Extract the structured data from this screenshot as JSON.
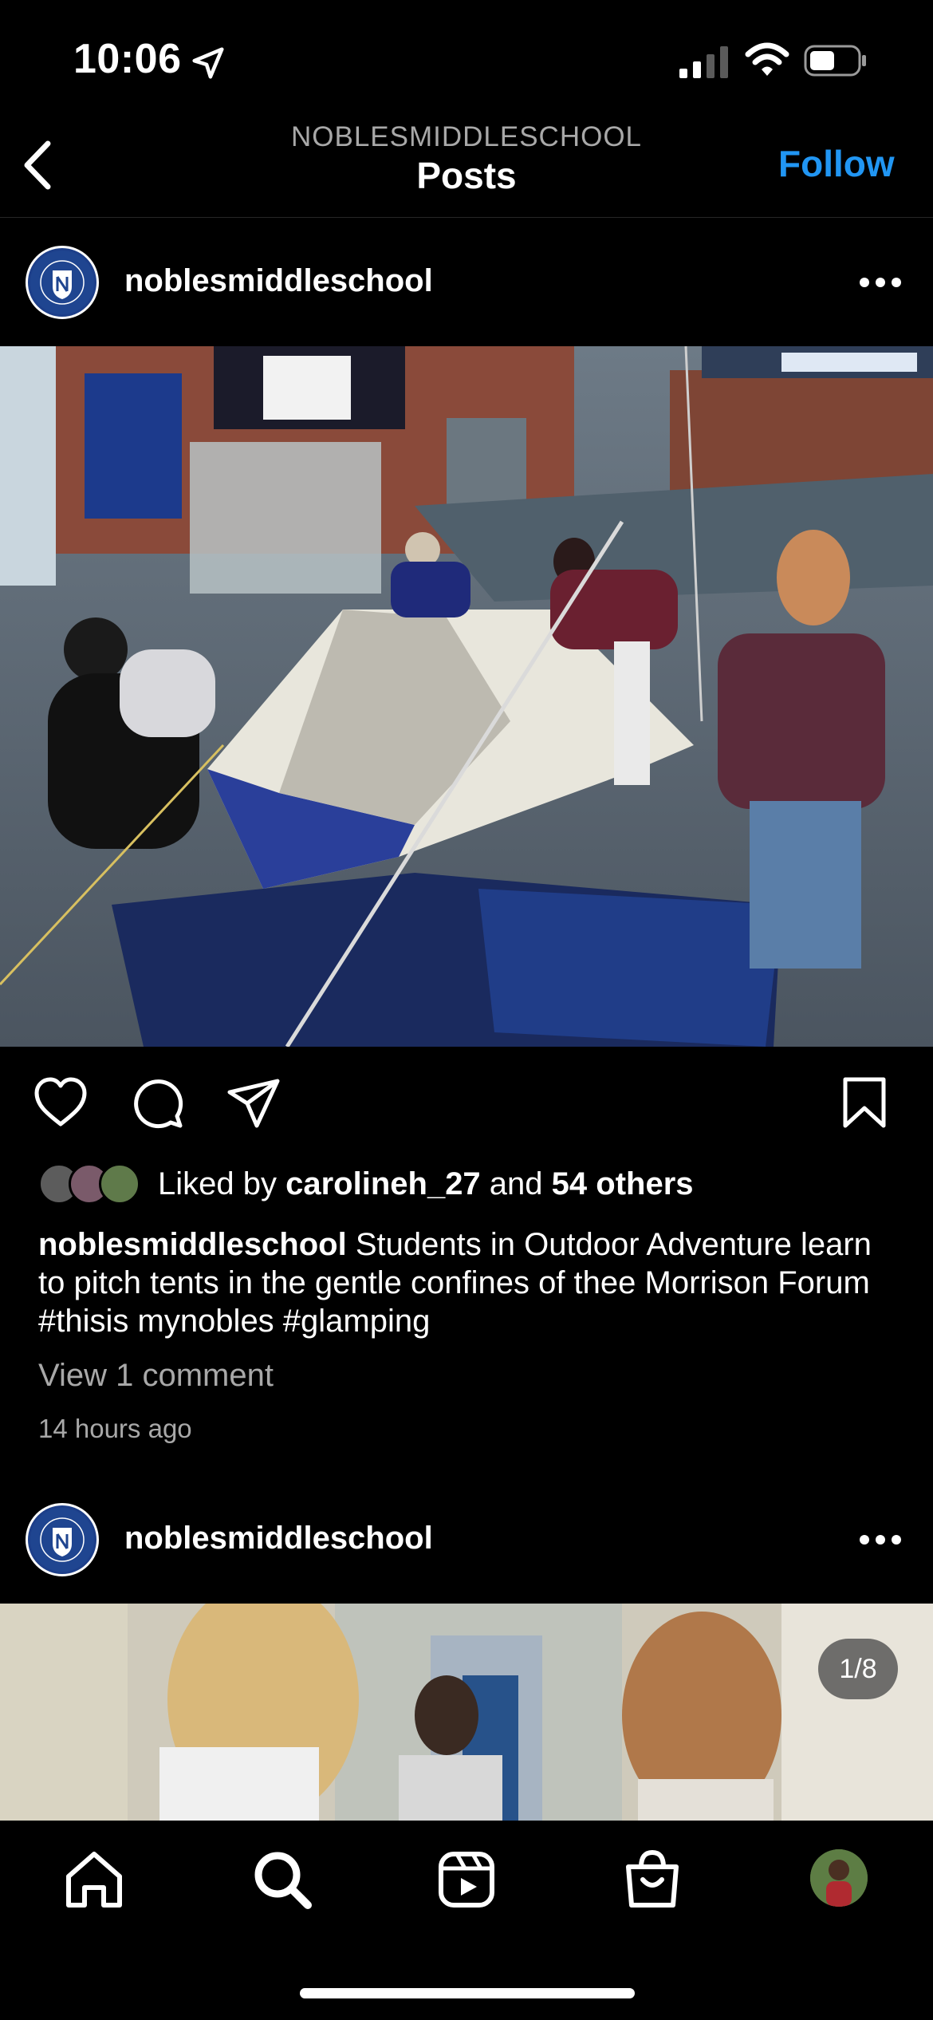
{
  "status_bar": {
    "time": "10:06"
  },
  "header": {
    "account": "NOBLESMIDDLESCHOOL",
    "title": "Posts",
    "follow_label": "Follow"
  },
  "post1": {
    "username": "noblesmiddleschool",
    "liked_by_prefix": "Liked by ",
    "liked_by_user": "carolineh_27",
    "liked_by_and": " and ",
    "liked_by_others": "54 others",
    "caption_user": "noblesmiddleschool",
    "caption_text": " Students in Outdoor Adventure learn to pitch tents in the gentle confines of thee Morrison Forum #thisis mynobles #glamping",
    "view_comments": "View 1 comment",
    "time_ago": "14 hours ago"
  },
  "post2": {
    "username": "noblesmiddleschool",
    "carousel_counter": "1/8"
  },
  "icons": {
    "status": [
      "location-arrow-icon",
      "signal-icon",
      "wifi-icon",
      "battery-icon"
    ],
    "header": [
      "back-chevron-icon"
    ],
    "post_actions": [
      "heart-icon",
      "comment-icon",
      "share-icon",
      "bookmark-icon"
    ],
    "tabs": [
      "home-icon",
      "search-icon",
      "reels-icon",
      "shop-icon",
      "profile-avatar"
    ]
  },
  "colors": {
    "background": "#000000",
    "accent": "#2196f3",
    "secondary_text": "#a8a8a8"
  }
}
